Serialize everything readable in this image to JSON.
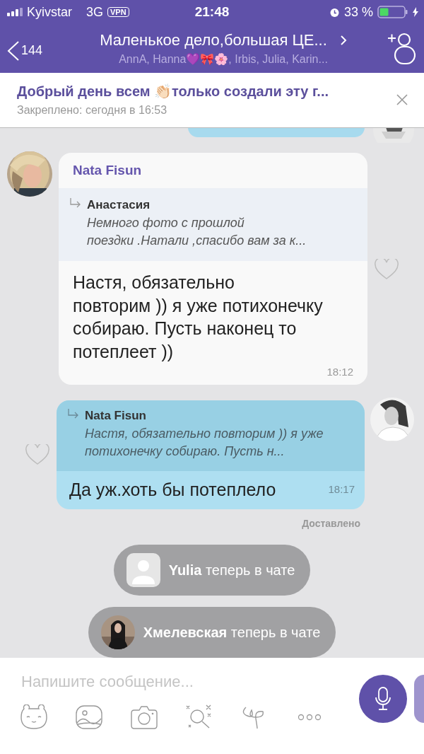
{
  "status_bar": {
    "carrier": "Kyivstar",
    "network": "3G",
    "vpn": "VPN",
    "time": "21:48",
    "battery": "33 %"
  },
  "header": {
    "back_count": "144",
    "title": "Маленькое дело,большая ЦЕ...",
    "subtitle": "AnnA, Hanna💜🎀🌸, Irbis, Julia, Karin..."
  },
  "pinned": {
    "text": "Добрый день всем 👏🏻только создали эту г...",
    "meta": "Закреплено: сегодня в 16:53"
  },
  "messages": [
    {
      "kind": "incoming",
      "sender": "Nata Fisun",
      "reply": {
        "author": "Анастасия",
        "text": "Немного фото с прошлой\nпоездки .Натали ,спасибо вам за к..."
      },
      "text": "Настя, обязательно\nповторим )) я уже потихонечку собираю. Пусть наконец то потеплеет ))",
      "time": "18:12"
    },
    {
      "kind": "outgoing",
      "reply": {
        "author": "Nata Fisun",
        "text": "Настя, обязательно повторим )) я уже потихонечку собираю. Пусть н..."
      },
      "text": "Да уж.хоть бы потеплело",
      "time": "18:17",
      "status": "Доставлено"
    },
    {
      "kind": "system",
      "avatar": {
        "kind": "placeholder"
      },
      "name": "Yulia",
      "text": "теперь в чате"
    },
    {
      "kind": "system",
      "name": "Хмелевская",
      "text": "теперь в чате"
    }
  ],
  "composer": {
    "placeholder": "Напишите сообщение..."
  }
}
